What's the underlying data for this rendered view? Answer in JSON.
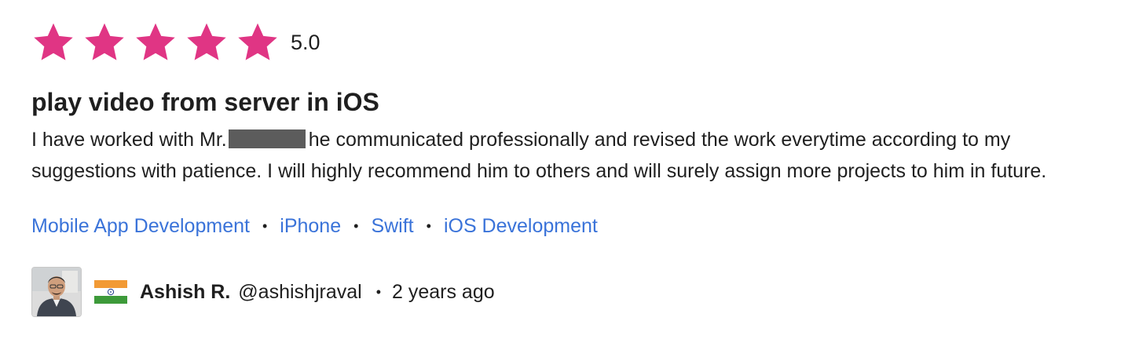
{
  "rating": {
    "stars_filled": 5,
    "stars_total": 5,
    "value_text": "5.0",
    "star_color": "#e03584",
    "icon": "star-icon"
  },
  "review": {
    "title": "play video from server in iOS",
    "body_before_redaction": "I have worked with Mr.",
    "body_after_redaction": "he communicated professionally and revised the work everytime according to my suggestions with patience. I will highly recommend him to others and will surely assign more projects to him in future."
  },
  "tags": [
    {
      "label": "Mobile App Development"
    },
    {
      "label": "iPhone"
    },
    {
      "label": "Swift"
    },
    {
      "label": "iOS Development"
    }
  ],
  "separator_char": "•",
  "reviewer": {
    "name": "Ashish R.",
    "handle": "@ashishjraval",
    "time_ago": "2 years ago",
    "country_flag_icon": "india-flag-icon",
    "avatar_icon": "user-avatar"
  },
  "colors": {
    "link": "#3a73d9",
    "text": "#1f1f1f",
    "redaction": "#5c5c5c"
  }
}
